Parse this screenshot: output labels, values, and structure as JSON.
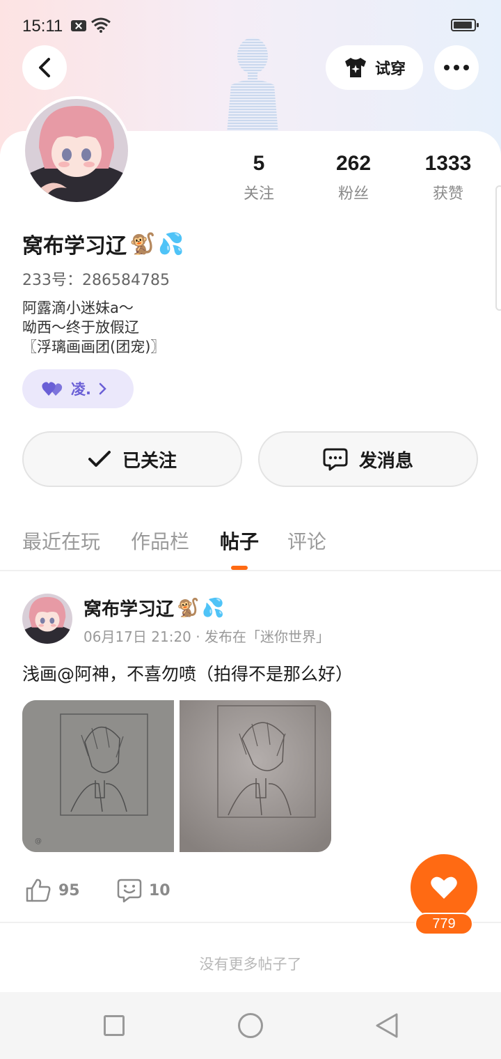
{
  "status_bar": {
    "time": "15:11"
  },
  "header": {
    "try_on_label": "试穿"
  },
  "profile": {
    "name": "窝布学习辽",
    "name_emojis": [
      "🐒",
      "💦"
    ],
    "uid": "233号：286584785",
    "bio": [
      "阿露滴小迷妹a～",
      "呦西～终于放假辽",
      "〖浮璃画画团(团宠)〗"
    ],
    "badge_label": "凌.",
    "stats": [
      {
        "value": "5",
        "label": "关注"
      },
      {
        "value": "262",
        "label": "粉丝"
      },
      {
        "value": "1333",
        "label": "获赞"
      }
    ]
  },
  "actions": {
    "follow_label": "已关注",
    "message_label": "发消息"
  },
  "tabs": [
    {
      "label": "最近在玩",
      "active": false
    },
    {
      "label": "作品栏",
      "active": false
    },
    {
      "label": "帖子",
      "active": true
    },
    {
      "label": "评论",
      "active": false
    }
  ],
  "post": {
    "author": "窝布学习辽",
    "meta": "06月17日 21:20 · 发布在「迷你世界」",
    "text": "浅画@阿神，不喜勿喷（拍得不是那么好）",
    "likes": "95",
    "comments": "10"
  },
  "fab": {
    "count": "779",
    "color": "#ff6a13"
  },
  "footer": {
    "no_more": "没有更多帖子了"
  },
  "colors": {
    "accent": "#ff6a13",
    "badge_text": "#6a5fd6",
    "badge_bg": "#ebe8fb"
  }
}
